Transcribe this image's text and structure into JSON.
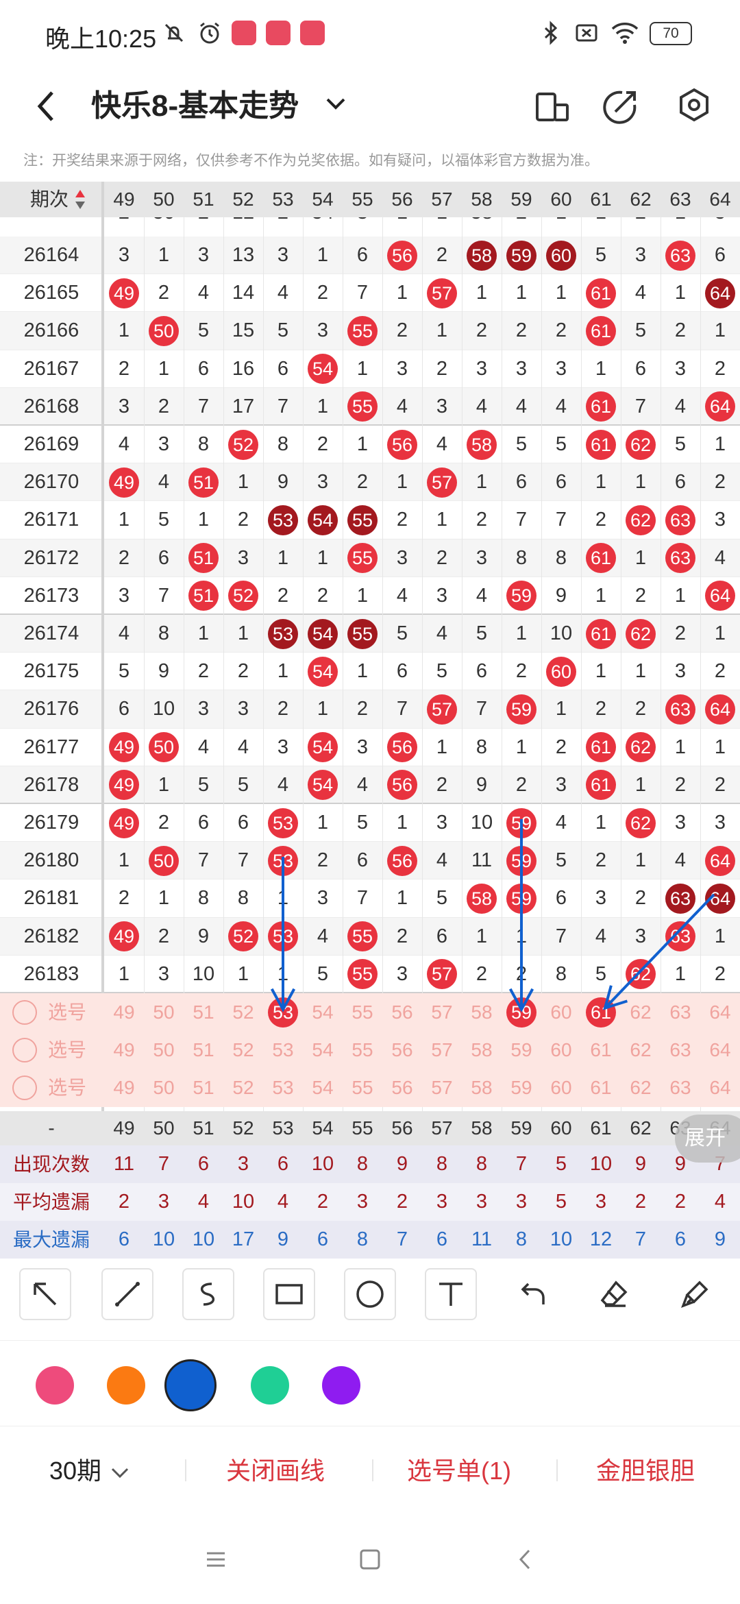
{
  "status_bar": {
    "time": "晚上10:25",
    "battery": "70"
  },
  "app_bar": {
    "title": "快乐8-基本走势"
  },
  "note": "注：开奖结果来源于网络，仅供参考不作为兑奖依据。如有疑问，以福体彩官方数据为准。",
  "table": {
    "period_header": "期次",
    "columns": [
      "49",
      "50",
      "51",
      "52",
      "53",
      "54",
      "55",
      "56",
      "57",
      "58",
      "59",
      "60",
      "61",
      "62",
      "63",
      "64"
    ],
    "partial_top_row": [
      "2",
      "50",
      "2",
      "12",
      "2",
      "54",
      "3",
      "1",
      "1",
      "58",
      "2",
      "1",
      "1",
      "2",
      "1",
      "5"
    ],
    "rows": [
      {
        "period": "26164",
        "cells": [
          "3",
          "1",
          "3",
          "13",
          "3",
          "1",
          "6",
          "56",
          "2",
          "58",
          "59",
          "60",
          "5",
          "3",
          "63",
          "6"
        ],
        "dark": [
          "58",
          "59",
          "60"
        ]
      },
      {
        "period": "26165",
        "cells": [
          "49",
          "2",
          "4",
          "14",
          "4",
          "2",
          "7",
          "1",
          "57",
          "1",
          "1",
          "1",
          "61",
          "4",
          "1",
          "64"
        ],
        "dark": [
          "64"
        ]
      },
      {
        "period": "26166",
        "cells": [
          "1",
          "50",
          "5",
          "15",
          "5",
          "3",
          "55",
          "2",
          "1",
          "2",
          "2",
          "2",
          "61",
          "5",
          "2",
          "1"
        ],
        "dark": []
      },
      {
        "period": "26167",
        "cells": [
          "2",
          "1",
          "6",
          "16",
          "6",
          "54",
          "1",
          "3",
          "2",
          "3",
          "3",
          "3",
          "1",
          "6",
          "3",
          "2"
        ],
        "dark": []
      },
      {
        "period": "26168",
        "cells": [
          "3",
          "2",
          "7",
          "17",
          "7",
          "1",
          "55",
          "4",
          "3",
          "4",
          "4",
          "4",
          "61",
          "7",
          "4",
          "64"
        ],
        "dark": []
      },
      {
        "period": "26169",
        "cells": [
          "4",
          "3",
          "8",
          "52",
          "8",
          "2",
          "1",
          "56",
          "4",
          "58",
          "5",
          "5",
          "61",
          "62",
          "5",
          "1"
        ],
        "dark": []
      },
      {
        "period": "26170",
        "cells": [
          "49",
          "4",
          "51",
          "1",
          "9",
          "3",
          "2",
          "1",
          "57",
          "1",
          "6",
          "6",
          "1",
          "1",
          "6",
          "2"
        ],
        "dark": []
      },
      {
        "period": "26171",
        "cells": [
          "1",
          "5",
          "1",
          "2",
          "53",
          "54",
          "55",
          "2",
          "1",
          "2",
          "7",
          "7",
          "2",
          "62",
          "63",
          "3"
        ],
        "dark": [
          "53",
          "54",
          "55"
        ]
      },
      {
        "period": "26172",
        "cells": [
          "2",
          "6",
          "51",
          "3",
          "1",
          "1",
          "55",
          "3",
          "2",
          "3",
          "8",
          "8",
          "61",
          "1",
          "63",
          "4"
        ],
        "dark": []
      },
      {
        "period": "26173",
        "cells": [
          "3",
          "7",
          "51",
          "52",
          "2",
          "2",
          "1",
          "4",
          "3",
          "4",
          "59",
          "9",
          "1",
          "2",
          "1",
          "64"
        ],
        "dark": []
      },
      {
        "period": "26174",
        "cells": [
          "4",
          "8",
          "1",
          "1",
          "53",
          "54",
          "55",
          "5",
          "4",
          "5",
          "1",
          "10",
          "61",
          "62",
          "2",
          "1"
        ],
        "dark": [
          "53",
          "54",
          "55"
        ]
      },
      {
        "period": "26175",
        "cells": [
          "5",
          "9",
          "2",
          "2",
          "1",
          "54",
          "1",
          "6",
          "5",
          "6",
          "2",
          "60",
          "1",
          "1",
          "3",
          "2"
        ],
        "dark": []
      },
      {
        "period": "26176",
        "cells": [
          "6",
          "10",
          "3",
          "3",
          "2",
          "1",
          "2",
          "7",
          "57",
          "7",
          "59",
          "1",
          "2",
          "2",
          "63",
          "64"
        ],
        "dark": []
      },
      {
        "period": "26177",
        "cells": [
          "49",
          "50",
          "4",
          "4",
          "3",
          "54",
          "3",
          "56",
          "1",
          "8",
          "1",
          "2",
          "61",
          "62",
          "1",
          "1"
        ],
        "dark": []
      },
      {
        "period": "26178",
        "cells": [
          "49",
          "1",
          "5",
          "5",
          "4",
          "54",
          "4",
          "56",
          "2",
          "9",
          "2",
          "3",
          "61",
          "1",
          "2",
          "2"
        ],
        "dark": []
      },
      {
        "period": "26179",
        "cells": [
          "49",
          "2",
          "6",
          "6",
          "53",
          "1",
          "5",
          "1",
          "3",
          "10",
          "59",
          "4",
          "1",
          "62",
          "3",
          "3"
        ],
        "dark": []
      },
      {
        "period": "26180",
        "cells": [
          "1",
          "50",
          "7",
          "7",
          "53",
          "2",
          "6",
          "56",
          "4",
          "11",
          "59",
          "5",
          "2",
          "1",
          "4",
          "64"
        ],
        "dark": []
      },
      {
        "period": "26181",
        "cells": [
          "2",
          "1",
          "8",
          "8",
          "1",
          "3",
          "7",
          "1",
          "5",
          "58",
          "59",
          "6",
          "3",
          "2",
          "63",
          "64"
        ],
        "dark": [
          "63",
          "64"
        ]
      },
      {
        "period": "26182",
        "cells": [
          "49",
          "2",
          "9",
          "52",
          "53",
          "4",
          "55",
          "2",
          "6",
          "1",
          "1",
          "7",
          "4",
          "3",
          "63",
          "1"
        ],
        "dark": []
      },
      {
        "period": "26183",
        "cells": [
          "1",
          "3",
          "10",
          "1",
          "1",
          "5",
          "55",
          "3",
          "57",
          "2",
          "2",
          "8",
          "5",
          "62",
          "1",
          "2"
        ],
        "dark": []
      }
    ],
    "pick_label": "选号",
    "pick_rows": [
      {
        "selected": [
          "53",
          "59",
          "61"
        ]
      },
      {
        "selected": []
      },
      {
        "selected": []
      }
    ],
    "footer_header_label": "-",
    "stats": [
      {
        "label": "出现次数",
        "values": [
          "11",
          "7",
          "6",
          "3",
          "6",
          "10",
          "8",
          "9",
          "8",
          "8",
          "7",
          "5",
          "10",
          "9",
          "9",
          "7"
        ],
        "color": "#a3191f"
      },
      {
        "label": "平均遗漏",
        "values": [
          "2",
          "3",
          "4",
          "10",
          "4",
          "2",
          "3",
          "2",
          "3",
          "3",
          "3",
          "5",
          "3",
          "2",
          "2",
          "4"
        ],
        "color": "#a3191f"
      },
      {
        "label": "最大遗漏",
        "values": [
          "6",
          "10",
          "10",
          "17",
          "9",
          "6",
          "8",
          "7",
          "6",
          "11",
          "8",
          "10",
          "12",
          "7",
          "6",
          "9"
        ],
        "color": "#2a6cc4"
      }
    ],
    "expand_label": "展开"
  },
  "drawing_tools": [
    "arrow-tool",
    "line-tool",
    "curve-tool",
    "rectangle-tool",
    "circle-tool",
    "text-tool",
    "undo-tool",
    "eraser-tool",
    "clear-tool"
  ],
  "colors": [
    "#ee4b7c",
    "#fb7a12",
    "#1060cf",
    "#1fcf95",
    "#8f1cf0"
  ],
  "selected_color": "#1060cf",
  "bottom_bar": {
    "periods": "30期",
    "close_lines": "关闭画线",
    "pick_list": "选号单(1)",
    "gold_silver": "金胆银胆"
  }
}
